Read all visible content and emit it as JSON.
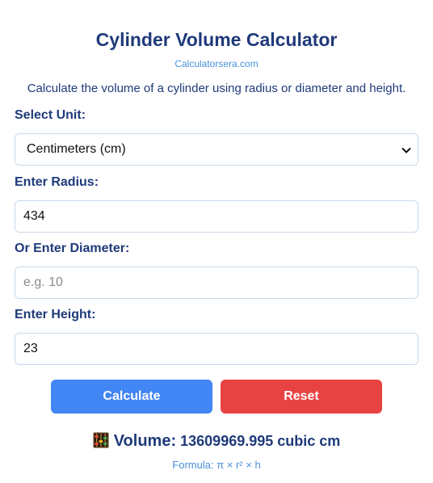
{
  "header": {
    "title": "Cylinder Volume Calculator",
    "site_link": "Calculatorsera.com",
    "description": "Calculate the volume of a cylinder using radius or diameter and height."
  },
  "form": {
    "unit_label": "Select Unit:",
    "unit_selected": "Centimeters (cm)",
    "radius_label": "Enter Radius:",
    "radius_value": "434",
    "diameter_label": "Or Enter Diameter:",
    "diameter_value": "",
    "diameter_placeholder": "e.g. 10",
    "height_label": "Enter Height:",
    "height_value": "23"
  },
  "buttons": {
    "calculate_label": "Calculate",
    "reset_label": "Reset"
  },
  "result": {
    "icon": "abacus-icon",
    "label": "Volume:",
    "value": "13609969.995 cubic cm",
    "formula": "Formula: π × r² × h"
  },
  "colors": {
    "heading": "#1f3a7a",
    "link": "#4a90d9",
    "calculate_button": "#4285f4",
    "reset_button": "#e84343",
    "field_border": "#c9d9ea"
  }
}
